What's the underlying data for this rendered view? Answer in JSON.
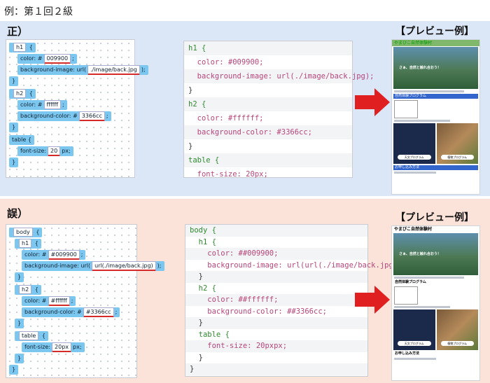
{
  "title": "例：第１回２級",
  "correct": {
    "label": "正）",
    "blocks": {
      "h1": "h1",
      "color_label": "color: #",
      "color_value": "009900",
      "bg_label": "background-image: url(",
      "bg_value": "./image/back.jpg",
      "bg_close": ")",
      "h2": "h2",
      "color2_value": "ffffff",
      "bgc_label": "background-color: #",
      "bgc_value": "3366cc",
      "table": "table",
      "fs_label": "font-size:",
      "fs_value": "20",
      "fs_unit": "px;",
      "brace_open": "{",
      "brace_close": "}",
      "semi": ";"
    },
    "code": [
      "h1 {",
      "  color: #009900;",
      "  background-image: url(./image/back.jpg);",
      "}",
      "h2 {",
      "  color: #ffffff;",
      "  background-color: #3366cc;",
      "}",
      "table {",
      "  font-size: 20px;",
      "}"
    ]
  },
  "wrong": {
    "label": "誤）",
    "blocks": {
      "body": "body",
      "h1": "h1",
      "color_label": "color: #",
      "color_value": "#009900",
      "bg_label": "background-image: url(",
      "bg_value": "url(./image/back.jpg)",
      "h2": "h2",
      "color2_value": "#ffffff",
      "bgc_label": "background-color: #",
      "bgc_value": "#3366cc",
      "table": "table",
      "fs_label": "font-size:",
      "fs_value": "20px",
      "fs_unit": "px;"
    },
    "code": [
      "body {",
      "  h1 {",
      "    color: ##009900;",
      "    background-image: url(url(./image/back.jpg));",
      "  }",
      "  h2 {",
      "    color: ##ffffff;",
      "    background-color: ##3366cc;",
      "  }",
      "  table {",
      "    font-size: 20pxpx;",
      "  }",
      "}"
    ]
  },
  "preview": {
    "title": "【プレビュー例】",
    "site_title": "やまびこ自然体験村",
    "hero_text": "さぁ、自然と触れ合おう！",
    "section1": "自然体験プログラム",
    "section2": "お申し込み方法",
    "btn1": "天文プログラム",
    "btn2": "植物プログラム"
  },
  "colors": {
    "accent_red": "#e02020",
    "block_blue": "#7cc7ef",
    "h1_green": "#009900",
    "h2_blue": "#3366cc"
  }
}
